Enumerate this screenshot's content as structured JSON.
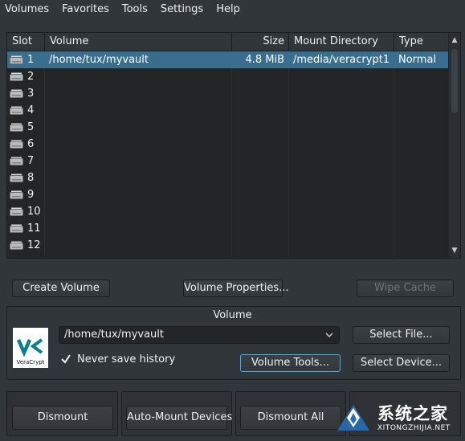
{
  "menu": [
    "Volumes",
    "Favorites",
    "Tools",
    "Settings",
    "Help"
  ],
  "table": {
    "headers": {
      "slot": "Slot",
      "volume": "Volume",
      "size": "Size",
      "mount_dir": "Mount Directory",
      "type": "Type"
    },
    "rows": [
      {
        "slot": "1",
        "volume": "/home/tux/myvault",
        "size": "4.8 MiB",
        "mount_dir": "/media/veracrypt1",
        "type": "Normal"
      },
      {
        "slot": "2",
        "volume": "",
        "size": "",
        "mount_dir": "",
        "type": ""
      },
      {
        "slot": "3",
        "volume": "",
        "size": "",
        "mount_dir": "",
        "type": ""
      },
      {
        "slot": "4",
        "volume": "",
        "size": "",
        "mount_dir": "",
        "type": ""
      },
      {
        "slot": "5",
        "volume": "",
        "size": "",
        "mount_dir": "",
        "type": ""
      },
      {
        "slot": "6",
        "volume": "",
        "size": "",
        "mount_dir": "",
        "type": ""
      },
      {
        "slot": "7",
        "volume": "",
        "size": "",
        "mount_dir": "",
        "type": ""
      },
      {
        "slot": "8",
        "volume": "",
        "size": "",
        "mount_dir": "",
        "type": ""
      },
      {
        "slot": "9",
        "volume": "",
        "size": "",
        "mount_dir": "",
        "type": ""
      },
      {
        "slot": "10",
        "volume": "",
        "size": "",
        "mount_dir": "",
        "type": ""
      },
      {
        "slot": "11",
        "volume": "",
        "size": "",
        "mount_dir": "",
        "type": ""
      },
      {
        "slot": "12",
        "volume": "",
        "size": "",
        "mount_dir": "",
        "type": ""
      }
    ],
    "selected_row": 0
  },
  "buttons": {
    "create_volume": "Create Volume",
    "volume_properties": "Volume Properties...",
    "wipe_cache": "Wipe Cache",
    "select_file": "Select File...",
    "volume_tools": "Volume Tools...",
    "select_device": "Select Device...",
    "dismount": "Dismount",
    "auto_mount": "Auto-Mount Devices",
    "dismount_all": "Dismount All"
  },
  "volume_group": {
    "title": "Volume",
    "path_value": "/home/tux/myvault",
    "never_save_history_label": "Never save history",
    "never_save_history_checked": true,
    "logo_text": "VeraCrypt"
  },
  "watermark": {
    "line1": "系统之家",
    "line2": "XITONGZHIJIA.NET"
  },
  "colors": {
    "background": "#31363b",
    "selection": "#3a6e8f",
    "focus": "#3daee9",
    "logo_accent": "#0a7f8c"
  }
}
